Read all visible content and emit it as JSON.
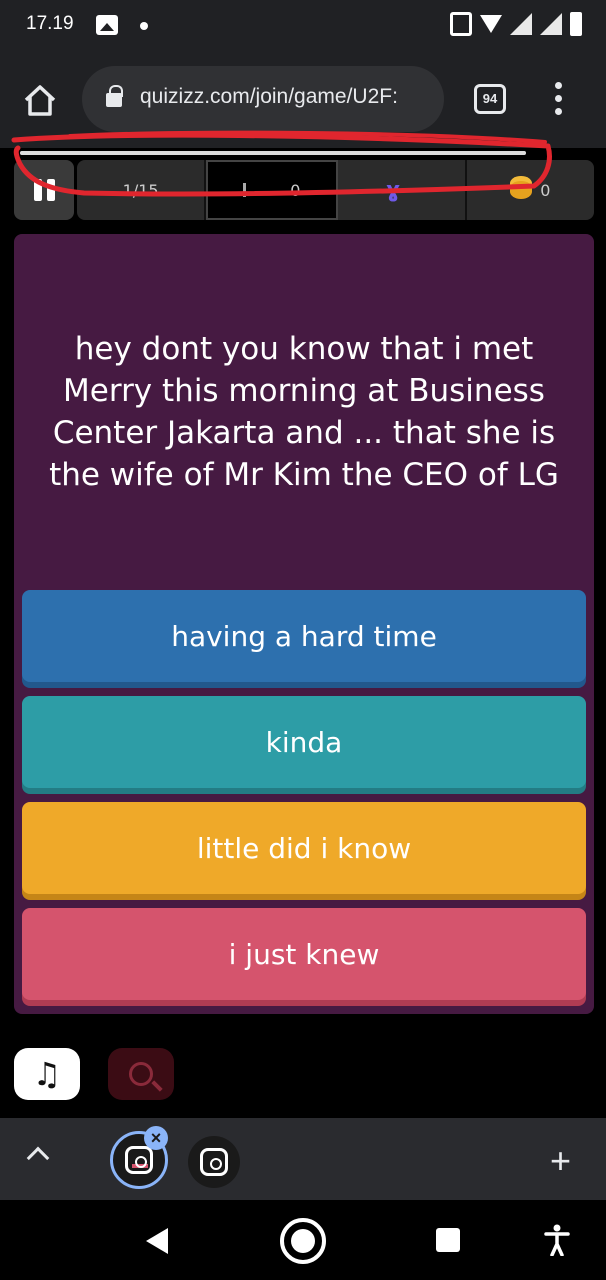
{
  "status_bar": {
    "time": "17.19",
    "icons": [
      "gallery-icon",
      "notification-dot-icon",
      "vibrate-icon",
      "wifi-icon",
      "signal-icon",
      "battery-icon"
    ]
  },
  "browser": {
    "url": "quizizz.com/join/game/U2F:",
    "tab_count": "94",
    "icons": [
      "home-icon",
      "lock-icon",
      "menu-dots-icon"
    ]
  },
  "game": {
    "progress_fraction": 1.0,
    "question_counter": "1/15",
    "timer_value": "0",
    "streak_value": "–",
    "coins": "0",
    "question": "hey dont you know that i met Merry this morning at Business Center Jakarta and ... that she is the wife of Mr Kim the CEO of LG",
    "options": [
      {
        "label": "having a hard time",
        "color": "#2d70ae"
      },
      {
        "label": "kinda",
        "color": "#2d9da6"
      },
      {
        "label": "little did i know",
        "color": "#efa929"
      },
      {
        "label": "i just knew",
        "color": "#d5546d"
      }
    ],
    "icons": [
      "pause-icon",
      "streak-icon",
      "coin-icon",
      "music-note-icon",
      "zoom-in-icon"
    ]
  },
  "bubbles_bar": {
    "icons": [
      "chevron-up-icon",
      "quizizz-bubble-icon",
      "close-icon",
      "plus-icon"
    ]
  },
  "annotation": {
    "color": "#e0262e"
  }
}
